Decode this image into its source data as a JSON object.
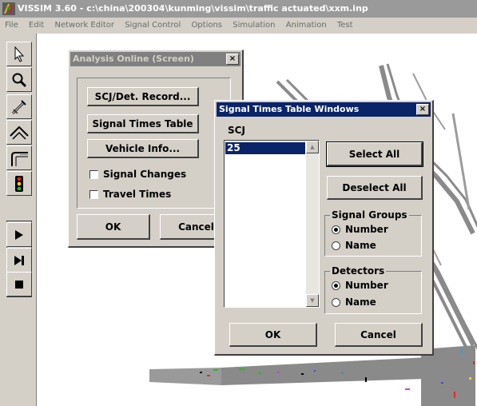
{
  "app": {
    "title": "VISSIM 3.60 - c:\\china\\200304\\kunming\\vissim\\traffic actuated\\xxm.inp"
  },
  "menu": [
    {
      "label": "File"
    },
    {
      "label": "Edit"
    },
    {
      "label": "Network Editor"
    },
    {
      "label": "Signal Control"
    },
    {
      "label": "Options"
    },
    {
      "label": "Simulation"
    },
    {
      "label": "Animation"
    },
    {
      "label": "Test"
    }
  ],
  "toolbar": {
    "icons": [
      "select-pointer",
      "zoom",
      "edit-link",
      "network",
      "connector",
      "signal-head",
      "play",
      "step",
      "stop"
    ]
  },
  "analysis_dialog": {
    "title": "Analysis Online (Screen)",
    "close": "×",
    "buttons": {
      "scj": "SCJ/Det. Record...",
      "signal_times": "Signal Times Table",
      "vehicle_info": "Vehicle Info..."
    },
    "checks": {
      "signal_changes": "Signal Changes",
      "travel_times": "Travel Times"
    },
    "ok": "OK",
    "cancel": "Cancel"
  },
  "signal_dialog": {
    "title": "Signal Times Table Windows",
    "close": "×",
    "scj_label": "SCJ",
    "list_items": [
      "25"
    ],
    "select_all": "Select All",
    "deselect_all": "Deselect All",
    "signal_groups": {
      "label": "Signal Groups",
      "number": "Number",
      "name": "Name",
      "selected": "number"
    },
    "detectors": {
      "label": "Detectors",
      "number": "Number",
      "name": "Name",
      "selected": "number"
    },
    "ok": "OK",
    "cancel": "Cancel"
  },
  "colors": {
    "active_title": "#0a246a",
    "inactive_title": "#808080",
    "face": "#d4d0c8",
    "road": "#8a8a8a"
  }
}
